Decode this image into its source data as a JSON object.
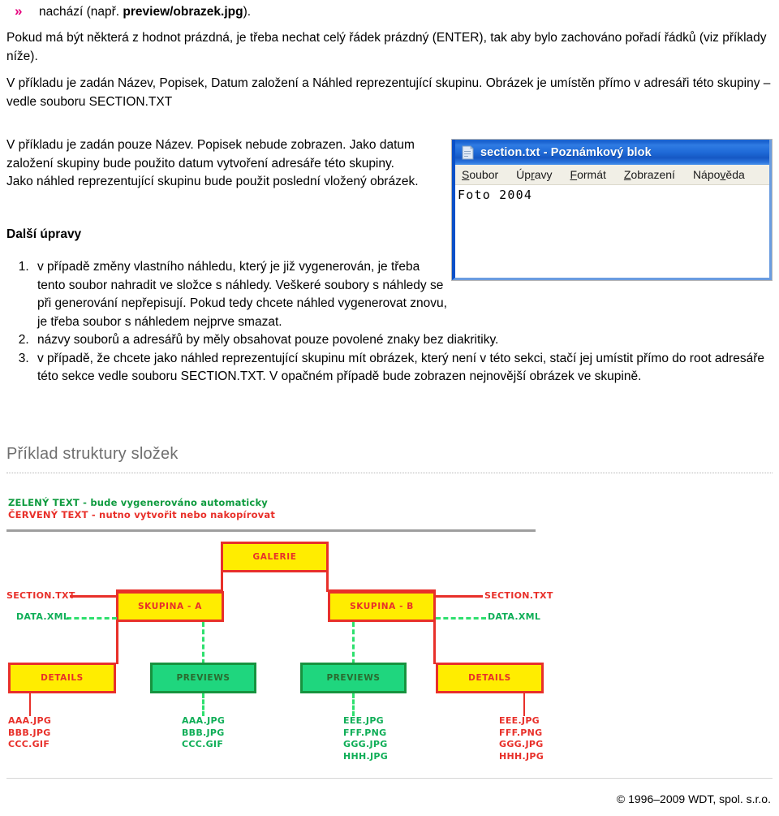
{
  "bullet": {
    "marker": "double-chevron",
    "marker_glyph": "»",
    "marker_color": "#e5007d",
    "text_before": "nachází (např. ",
    "text_bold": "preview/obrazek.jpg",
    "text_after": ")."
  },
  "paragraphs": {
    "p1": "Pokud má být některá z hodnot prázdná, je třeba nechat celý řádek prázdný (ENTER), tak aby bylo zachováno pořadí řádků (viz příklady níže).",
    "p2": "V příkladu je zadán Název, Popisek, Datum založení a Náhled reprezentující skupinu. Obrázek je umístěn přímo v adresáři této skupiny – vedle souboru SECTION.TXT",
    "p3": "V příkladu je zadán pouze Název. Popisek nebude zobrazen. Jako datum založení skupiny bude použito datum vytvoření adresáře této skupiny. Jako náhled reprezentující skupinu bude použit poslední vložený obrázek."
  },
  "subheading": "Další úpravy",
  "steps": [
    "v případě změny vlastního náhledu, který je již vygenerován, je třeba tento soubor nahradit ve složce s náhledy. Veškeré soubory s náhledy se při generování nepřepisují. Pokud tedy chcete náhled vygenerovat znovu, je třeba soubor s náhledem nejprve smazat.",
    "názvy souborů a adresářů by měly obsahovat pouze povolené znaky bez diakritiky.",
    "v případě, že chcete jako náhled reprezentující skupinu mít obrázek, který není v této sekci, stačí jej umístit přímo do root adresáře této sekce vedle souboru SECTION.TXT. V opačném případě bude zobrazen nejnovější obrázek ve skupině."
  ],
  "notepad": {
    "icon": "notepad-document-icon",
    "title": "section.txt - Poznámkový blok",
    "menu": [
      {
        "pre": "S",
        "post": "oubor"
      },
      {
        "pre": "Úp",
        "mid": "r",
        "post": "avy"
      },
      {
        "pre": "F",
        "post": "ormát"
      },
      {
        "pre": "Z",
        "post": "obrazení"
      },
      {
        "pre": "Nápo",
        "mid": "v",
        "post": "ěda"
      }
    ],
    "menu_labels": [
      "Soubor",
      "Úpravy",
      "Formát",
      "Zobrazení",
      "Nápověda"
    ],
    "content": "Foto 2004",
    "titlebar_color": "#1f6ad8"
  },
  "section": {
    "heading": "Příklad struktury složek"
  },
  "diagram": {
    "legend": {
      "green_line": "ZELENÝ TEXT - bude vygenerováno automaticky",
      "red_line": "ČERVENÝ TEXT - nutno vytvořit nebo nakopírovat",
      "green_color": "#0f9b3f",
      "red_color": "#e8302a"
    },
    "colors": {
      "node_yellow_fill": "#ffed00",
      "node_yellow_border": "#e8302a",
      "node_green_fill": "#1fd67e",
      "node_green_border": "#17933f",
      "edge_red": "#e8302a",
      "edge_green": "#2ee06e"
    },
    "nodes": {
      "root": "GALERIE",
      "group_a": "SKUPINA - A",
      "group_b": "SKUPINA - B",
      "details_left": "DETAILS",
      "previews_left": "PREVIEWS",
      "previews_right": "PREVIEWS",
      "details_right": "DETAILS"
    },
    "side_labels": {
      "section_txt_left": "SECTION.TXT",
      "data_xml_left": "DATA.XML",
      "section_txt_right": "SECTION.TXT",
      "data_xml_right": "DATA.XML"
    },
    "files": {
      "details_left": "AAA.JPG\nBBB.JPG\nCCC.GIF",
      "previews_left": "AAA.JPG\nBBB.JPG\nCCC.GIF",
      "previews_right": "EEE.JPG\nFFF.PNG\nGGG.JPG\nHHH.JPG",
      "details_right": "EEE.JPG\nFFF.PNG\nGGG.JPG\nHHH.JPG"
    }
  },
  "footer": {
    "copyright": "© 1996–2009 WDT, spol. s.r.o."
  }
}
